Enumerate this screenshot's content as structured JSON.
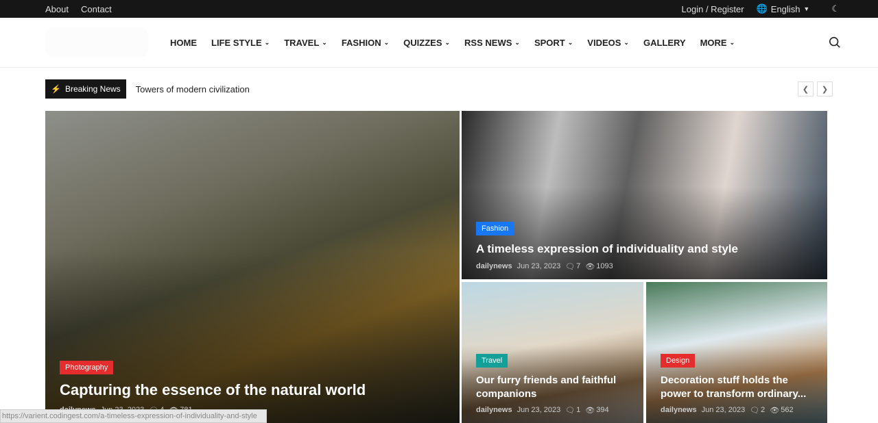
{
  "topbar": {
    "links": [
      "About",
      "Contact"
    ],
    "login": "Login / Register",
    "language": "English",
    "icons": {
      "globe": "globe-icon",
      "theme": "moon-icon"
    }
  },
  "nav": {
    "items": [
      {
        "label": "HOME",
        "dropdown": false
      },
      {
        "label": "LIFE STYLE",
        "dropdown": true
      },
      {
        "label": "TRAVEL",
        "dropdown": true
      },
      {
        "label": "FASHION",
        "dropdown": true
      },
      {
        "label": "QUIZZES",
        "dropdown": true
      },
      {
        "label": "RSS NEWS",
        "dropdown": true
      },
      {
        "label": "SPORT",
        "dropdown": true
      },
      {
        "label": "VIDEOS",
        "dropdown": true
      },
      {
        "label": "GALLERY",
        "dropdown": false
      },
      {
        "label": "MORE",
        "dropdown": true
      }
    ]
  },
  "breaking": {
    "label": "Breaking News",
    "text": "Towers of modern civilization"
  },
  "posts": [
    {
      "category": "Photography",
      "color": "#e52d2d",
      "title": "Capturing the essence of the natural world",
      "author": "dailynews",
      "date": "Jun 23, 2023",
      "comments": "4",
      "views": "781"
    },
    {
      "category": "Fashion",
      "color": "#1877f2",
      "title": "A timeless expression of individuality and style",
      "author": "dailynews",
      "date": "Jun 23, 2023",
      "comments": "7",
      "views": "1093"
    },
    {
      "category": "Travel",
      "color": "#14a098",
      "title": "Our furry friends and faithful companions",
      "author": "dailynews",
      "date": "Jun 23, 2023",
      "comments": "1",
      "views": "394"
    },
    {
      "category": "Design",
      "color": "#e52d2d",
      "title": "Decoration stuff holds the power to transform ordinary...",
      "author": "dailynews",
      "date": "Jun 23, 2023",
      "comments": "2",
      "views": "562"
    }
  ],
  "status_url": "https://varient.codingest.com/a-timeless-expression-of-individuality-and-style"
}
